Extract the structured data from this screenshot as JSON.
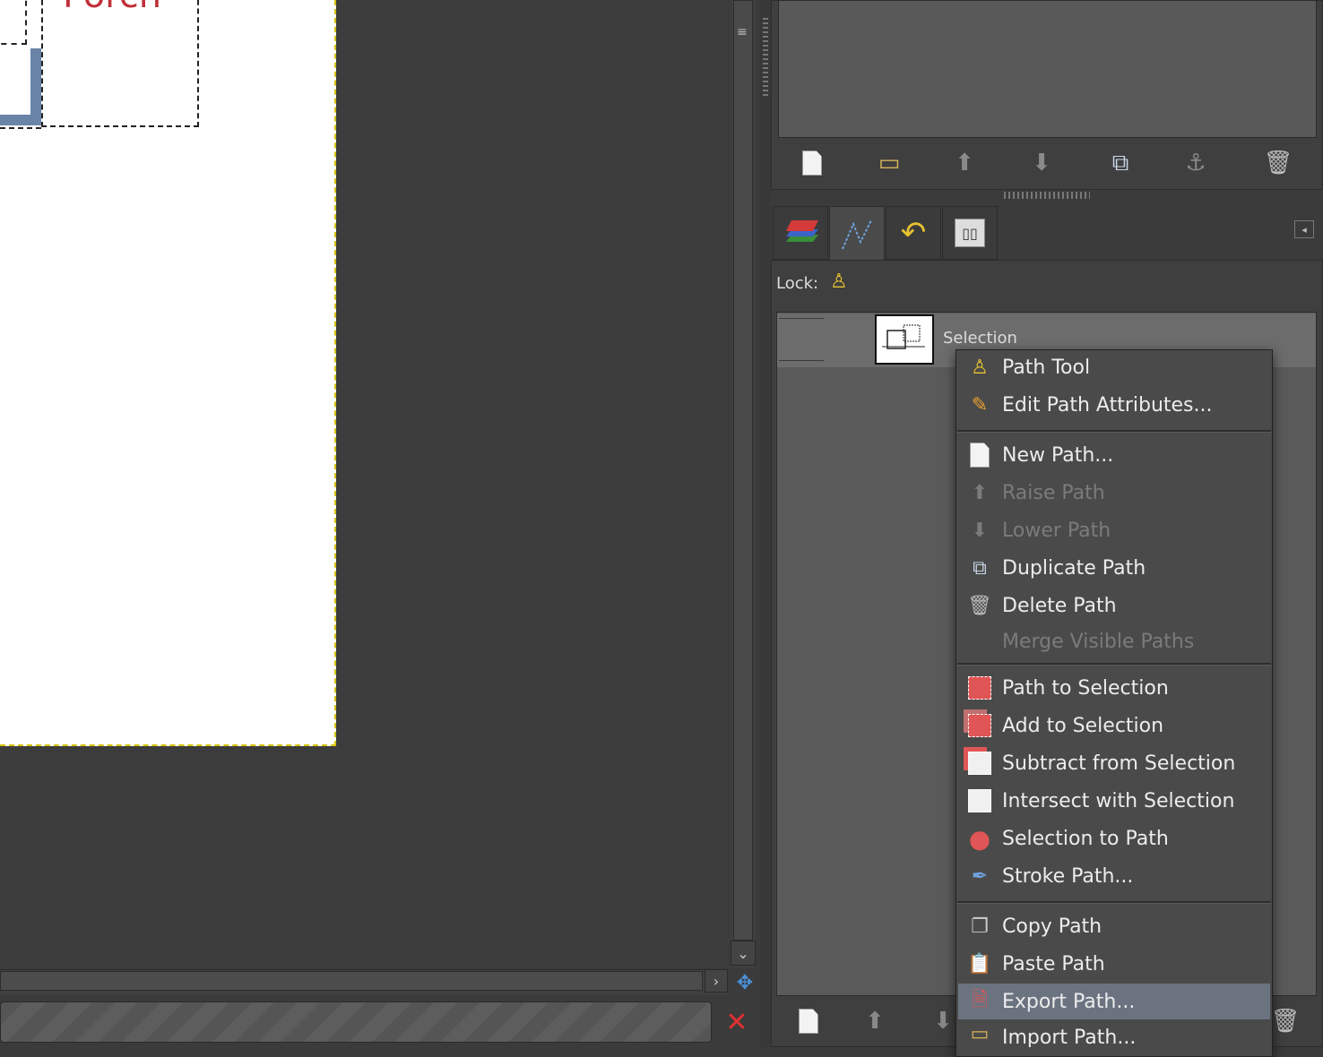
{
  "canvas": {
    "label_text": "Porch"
  },
  "lock_label": "Lock:",
  "path_layer": {
    "name": "Selection"
  },
  "menu": {
    "path_tool": "Path Tool",
    "edit_attributes": "Edit Path Attributes...",
    "new_path": "New Path...",
    "raise_path": "Raise Path",
    "lower_path": "Lower Path",
    "duplicate_path": "Duplicate Path",
    "delete_path": "Delete Path",
    "merge_visible": "Merge Visible Paths",
    "path_to_selection": "Path to Selection",
    "add_to_selection": "Add to Selection",
    "subtract_from_selection": "Subtract from Selection",
    "intersect_with_selection": "Intersect with Selection",
    "selection_to_path": "Selection to Path",
    "stroke_path": "Stroke Path...",
    "copy_path": "Copy Path",
    "paste_path": "Paste Path",
    "export_path": "Export Path...",
    "import_path": "Import Path..."
  },
  "icons": {
    "new": "new-icon",
    "open": "folder-icon",
    "raise": "arrow-up-icon",
    "lower": "arrow-down-icon",
    "duplicate": "duplicate-icon",
    "anchor": "anchor-icon",
    "delete": "trash-icon"
  },
  "colors": {
    "menu_highlight": "#6b7380",
    "selection_marching_ants": "#d4c200",
    "porch_text": "#c0303a",
    "cancel_red": "#e03030"
  }
}
